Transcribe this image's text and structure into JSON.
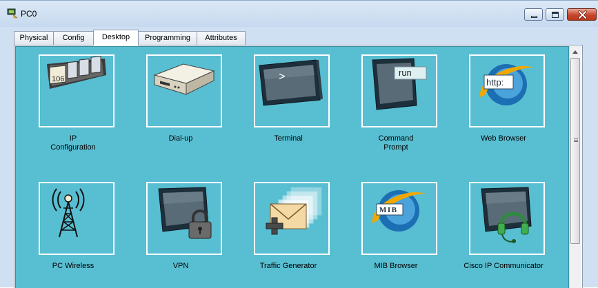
{
  "window": {
    "title": "PC0",
    "icon": "pc-app-icon",
    "controls": [
      "minimize-icon",
      "maximize-icon",
      "close-icon"
    ]
  },
  "tabs": [
    {
      "label": "Physical",
      "active": false
    },
    {
      "label": "Config",
      "active": false
    },
    {
      "label": "Desktop",
      "active": true
    },
    {
      "label": "Programming",
      "active": false
    },
    {
      "label": "Attributes",
      "active": false
    }
  ],
  "desktop": {
    "background_color": "#58bed1",
    "apps": [
      {
        "lines": [
          "IP",
          "Configuration"
        ],
        "icon": "ip-configuration-icon",
        "icon_text": "106"
      },
      {
        "lines": [
          "Dial-up"
        ],
        "icon": "dial-up-modem-icon"
      },
      {
        "lines": [
          "Terminal"
        ],
        "icon": "terminal-icon",
        "icon_text": ">"
      },
      {
        "lines": [
          "Command",
          "Prompt"
        ],
        "icon": "command-prompt-icon",
        "icon_text": "run"
      },
      {
        "lines": [
          "Web Browser"
        ],
        "icon": "web-browser-icon",
        "icon_text": "http:"
      },
      {
        "lines": [
          "PC Wireless"
        ],
        "icon": "wireless-antenna-icon"
      },
      {
        "lines": [
          "VPN"
        ],
        "icon": "vpn-lock-icon"
      },
      {
        "lines": [
          "Traffic Generator"
        ],
        "icon": "traffic-generator-icon"
      },
      {
        "lines": [
          "MIB Browser"
        ],
        "icon": "mib-browser-icon",
        "icon_text": "MIB"
      },
      {
        "lines": [
          "Cisco IP Communicator"
        ],
        "icon": "cisco-ip-communicator-icon"
      }
    ]
  }
}
